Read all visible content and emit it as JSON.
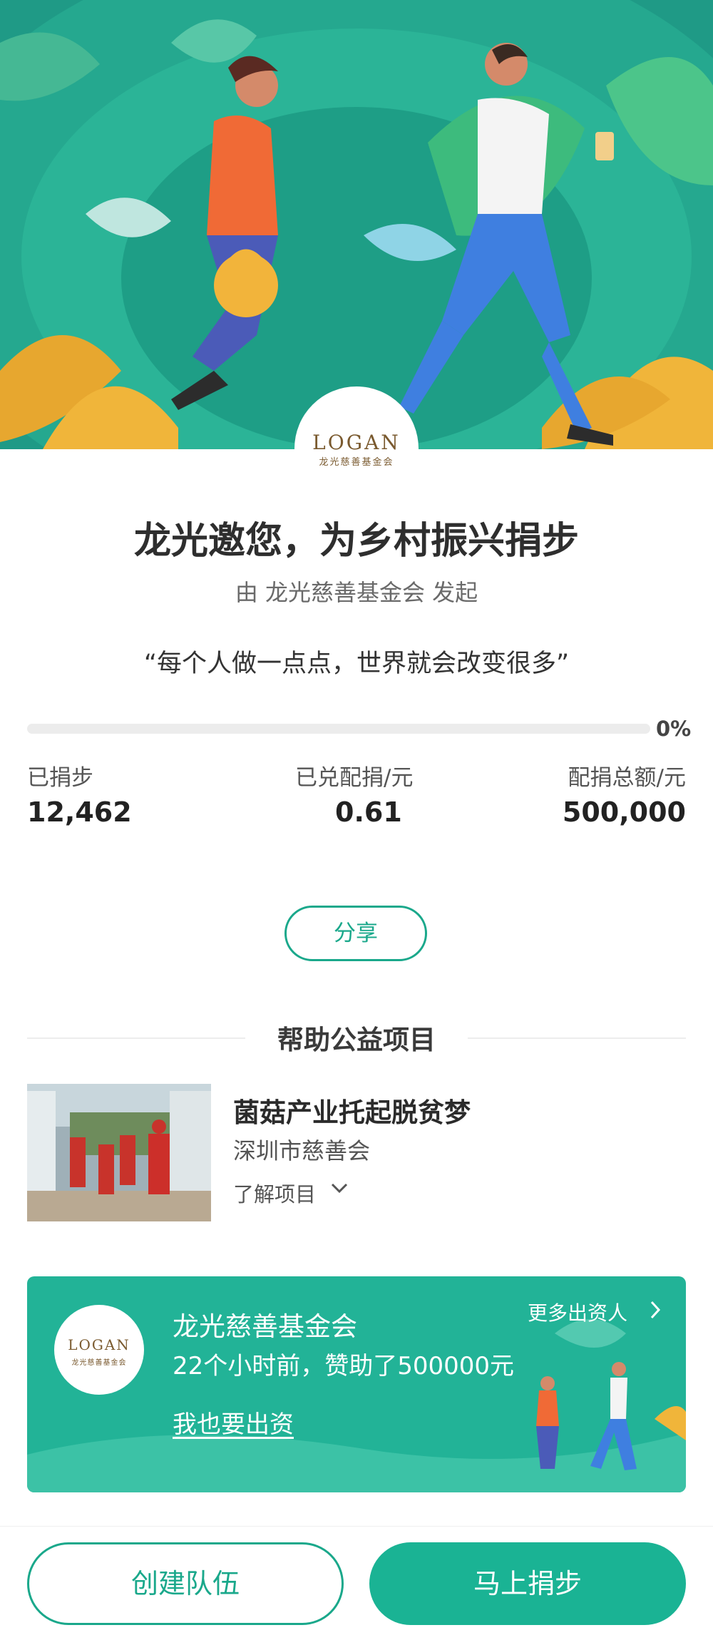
{
  "hero": {
    "logo_text": "LOGAN",
    "logo_subtext": "龙光慈善基金会"
  },
  "campaign": {
    "title": "龙光邀您，为乡村振兴捐步",
    "subtitle": "由 龙光慈善基金会 发起",
    "quote": "“每个人做一点点，世界就会改变很多”"
  },
  "progress": {
    "percent_label": "0%",
    "fraction": 0.0
  },
  "stats": [
    {
      "label": "已捐步",
      "value": "12,462"
    },
    {
      "label": "已兑配捐/元",
      "value": "0.61"
    },
    {
      "label": "配捐总额/元",
      "value": "500,000"
    }
  ],
  "share_label": "分享",
  "section_title": "帮助公益项目",
  "project": {
    "name": "菌菇产业托起脱贫梦",
    "org": "深圳市慈善会",
    "more_label": "了解项目"
  },
  "sponsor_card": {
    "logo_text": "LOGAN",
    "logo_subtext": "龙光慈善基金会",
    "name": "龙光慈善基金会",
    "description": "22个小时前，赞助了500000元",
    "cta": "我也要出资",
    "more": "更多出资人"
  },
  "bottom": {
    "create_team": "创建队伍",
    "donate_now": "马上捐步"
  },
  "colors": {
    "brand_green": "#1ab394",
    "hero_green": "#1f9a86",
    "logo_brown": "#7a5a2f"
  }
}
